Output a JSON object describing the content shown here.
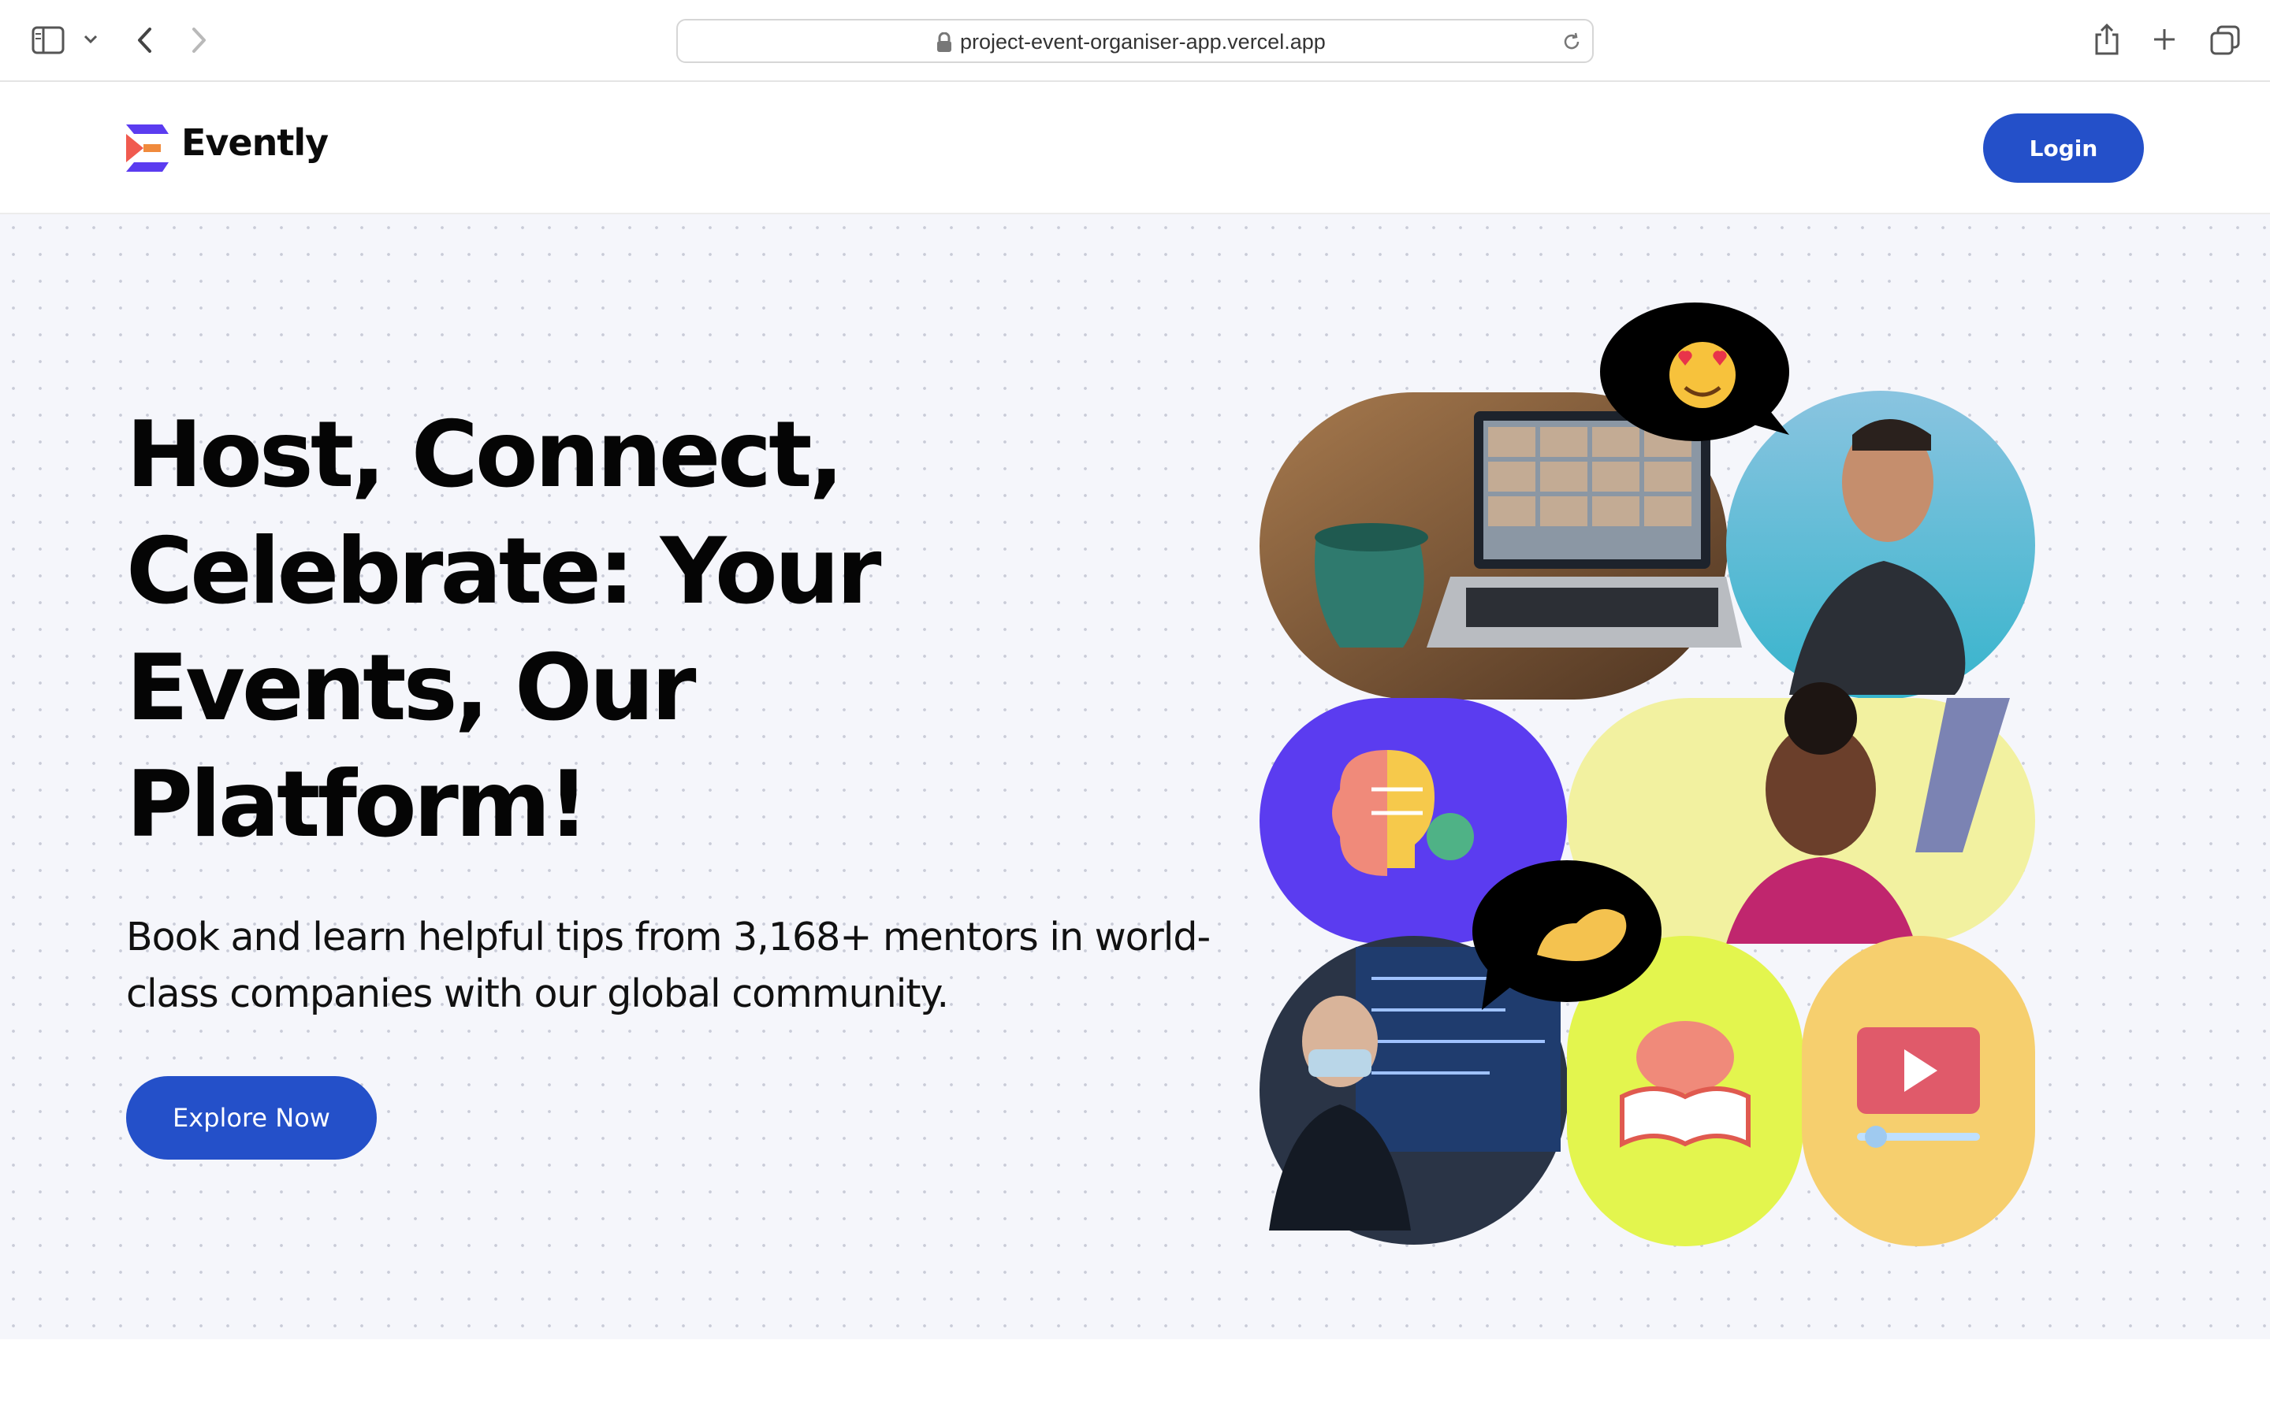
{
  "browser": {
    "url": "project-event-organiser-app.vercel.app"
  },
  "header": {
    "brand": "Evently",
    "login_label": "Login"
  },
  "hero": {
    "title": "Host, Connect, Celebrate: Your Events, Our Platform!",
    "subtitle": "Book and learn helpful tips from 3,168+ mentors in world-class companies with our global community.",
    "cta_label": "Explore Now",
    "tiles": [
      {
        "name": "video-call-laptop-image",
        "bg": "#7a5a3e"
      },
      {
        "name": "smiling-man-image",
        "bg": "#36b4cc"
      },
      {
        "name": "brain-bulb-illustration",
        "bg": "#5b3cf0"
      },
      {
        "name": "smiling-woman-image",
        "bg": "#f2f1a0"
      },
      {
        "name": "presenter-image",
        "bg": "#2a3446"
      },
      {
        "name": "brain-book-illustration",
        "bg": "#e3f54e"
      },
      {
        "name": "video-player-illustration",
        "bg": "#f6cf6e"
      }
    ],
    "bubbles": [
      {
        "name": "heart-eyes-emoji-bubble",
        "icon": "heart-eyes-emoji"
      },
      {
        "name": "flexed-arm-emoji-bubble",
        "icon": "flexed-biceps-emoji"
      }
    ]
  },
  "colors": {
    "primary": "#2450c9",
    "hero_bg": "#f5f6fb",
    "logo_red": "#f05a4f",
    "logo_purple": "#5b3cf0"
  }
}
